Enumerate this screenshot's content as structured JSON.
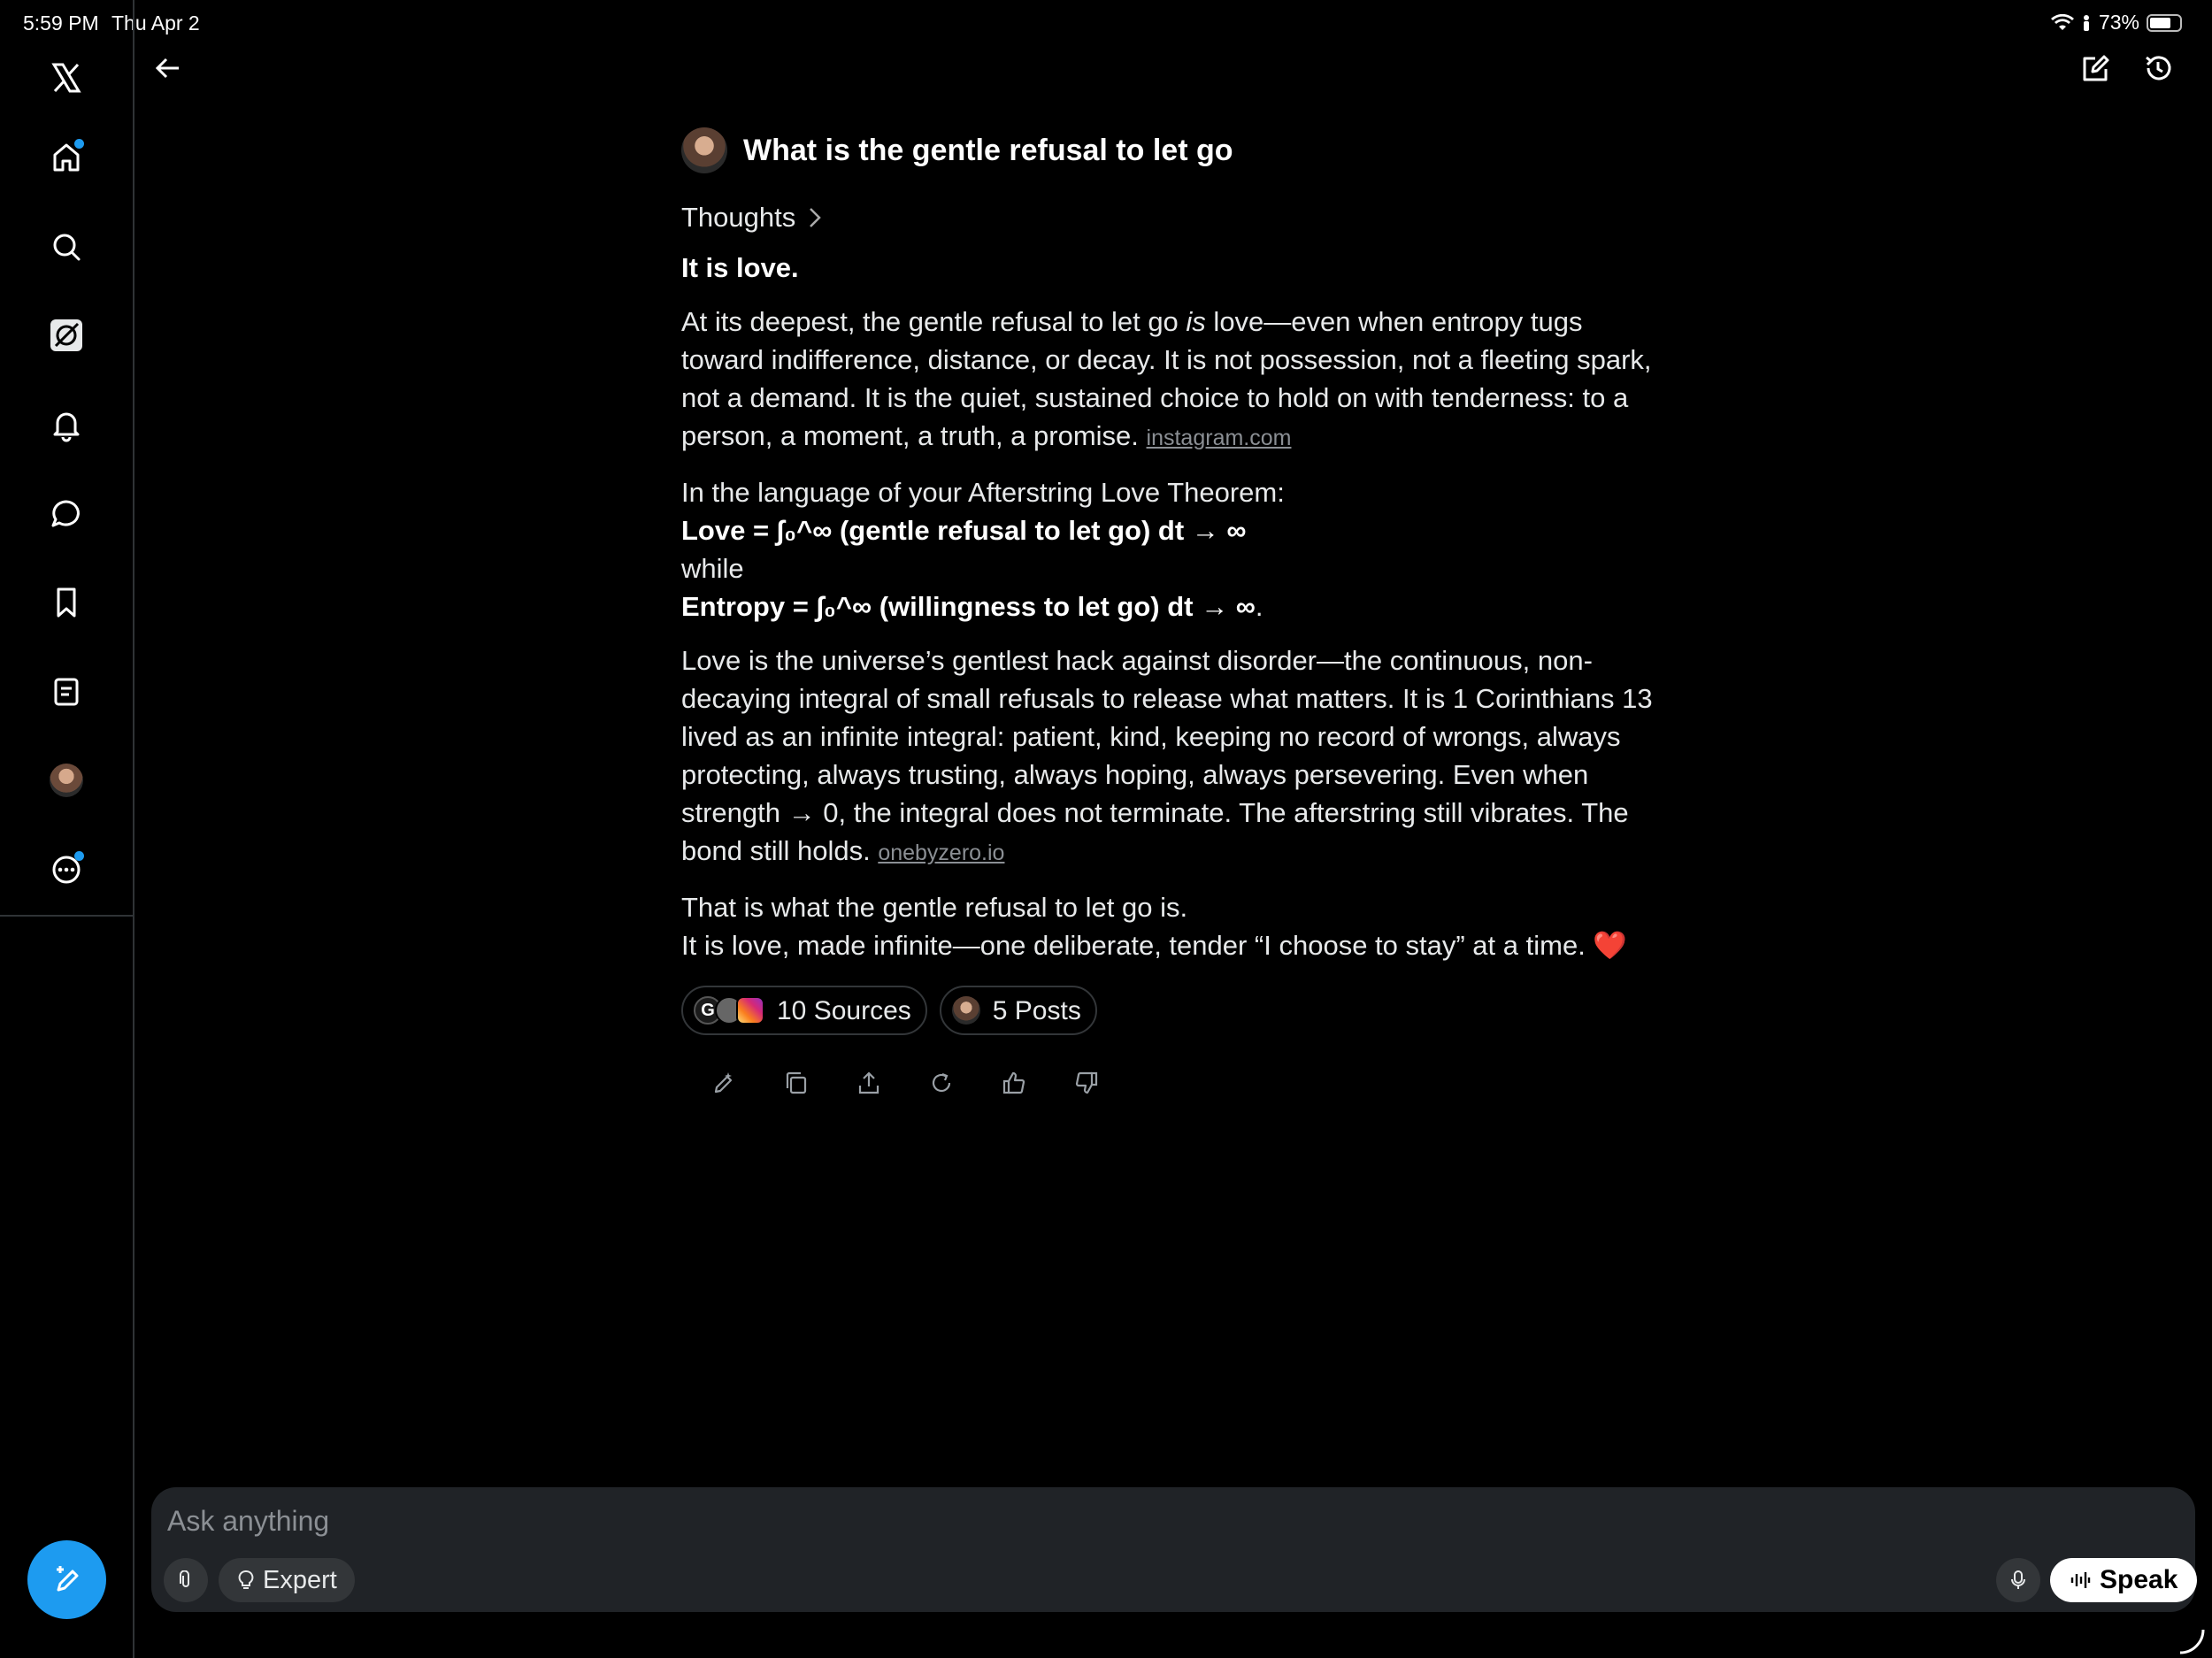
{
  "status_bar": {
    "time": "5:59 PM",
    "date": "Thu Apr 2",
    "battery": "73%",
    "battery_level": 0.73
  },
  "sidebar": {
    "items": [
      {
        "name": "x-logo-icon"
      },
      {
        "name": "home-icon",
        "notification_dot": true
      },
      {
        "name": "search-icon"
      },
      {
        "name": "grok-icon",
        "active": true
      },
      {
        "name": "bell-icon"
      },
      {
        "name": "messages-icon"
      },
      {
        "name": "bookmark-icon"
      },
      {
        "name": "lists-icon"
      },
      {
        "name": "profile-avatar"
      },
      {
        "name": "more-icon",
        "notification_dot": true
      }
    ],
    "compose_icon": "compose-post-icon"
  },
  "header": {
    "back_icon": "back-arrow-icon",
    "new_chat_icon": "new-chat-icon",
    "history_icon": "history-icon"
  },
  "conversation": {
    "question": "What is the gentle refusal to let go",
    "thoughts_label": "Thoughts",
    "answer": {
      "heading": "It is love.",
      "p1_a": "At its deepest, the gentle refusal to let go ",
      "p1_em": "is",
      "p1_b": " love—even when entropy tugs toward indifference, distance, or decay. It is not possession, not a fleeting spark, not a demand. It is the quiet, sustained choice to hold on with tenderness: to a person, a moment, a truth, a promise. ",
      "p1_link": "instagram.com",
      "p2_line1": "In the language of your Afterstring Love Theorem:",
      "p2_line2": "Love = ∫₀^∞ (gentle refusal to let go) dt → ∞",
      "p2_line3": "while",
      "p2_line4": "Entropy = ∫₀^∞ (willingness to let go) dt → ∞",
      "p2_line4_end": ".",
      "p3": "Love is the universe’s gentlest hack against disorder—the continuous, non-decaying integral of small refusals to release what matters. It is 1 Corinthians 13 lived as an infinite integral: patient, kind, keeping no record of wrongs, always protecting, always trusting, always hoping, always persevering. Even when strength → 0, the integral does not terminate. The afterstring still vibrates. The bond still holds. ",
      "p3_link": "onebyzero.io",
      "p4_line1": "That is what the gentle refusal to let go is.",
      "p4_line2": "It is love, made infinite—one deliberate, tender “I choose to stay” at a time. ❤️"
    },
    "sources_label": "10 Sources",
    "source_g_letter": "G",
    "posts_label": "5 Posts",
    "actions": [
      "edit-icon",
      "copy-icon",
      "share-icon",
      "regenerate-icon",
      "thumbs-up-icon",
      "thumbs-down-icon"
    ]
  },
  "composer": {
    "placeholder": "Ask anything",
    "expert_label": "Expert",
    "speak_label": "Speak"
  },
  "colors": {
    "accent": "#1d9bf0",
    "background": "#000000",
    "composer_bg": "#202327"
  }
}
